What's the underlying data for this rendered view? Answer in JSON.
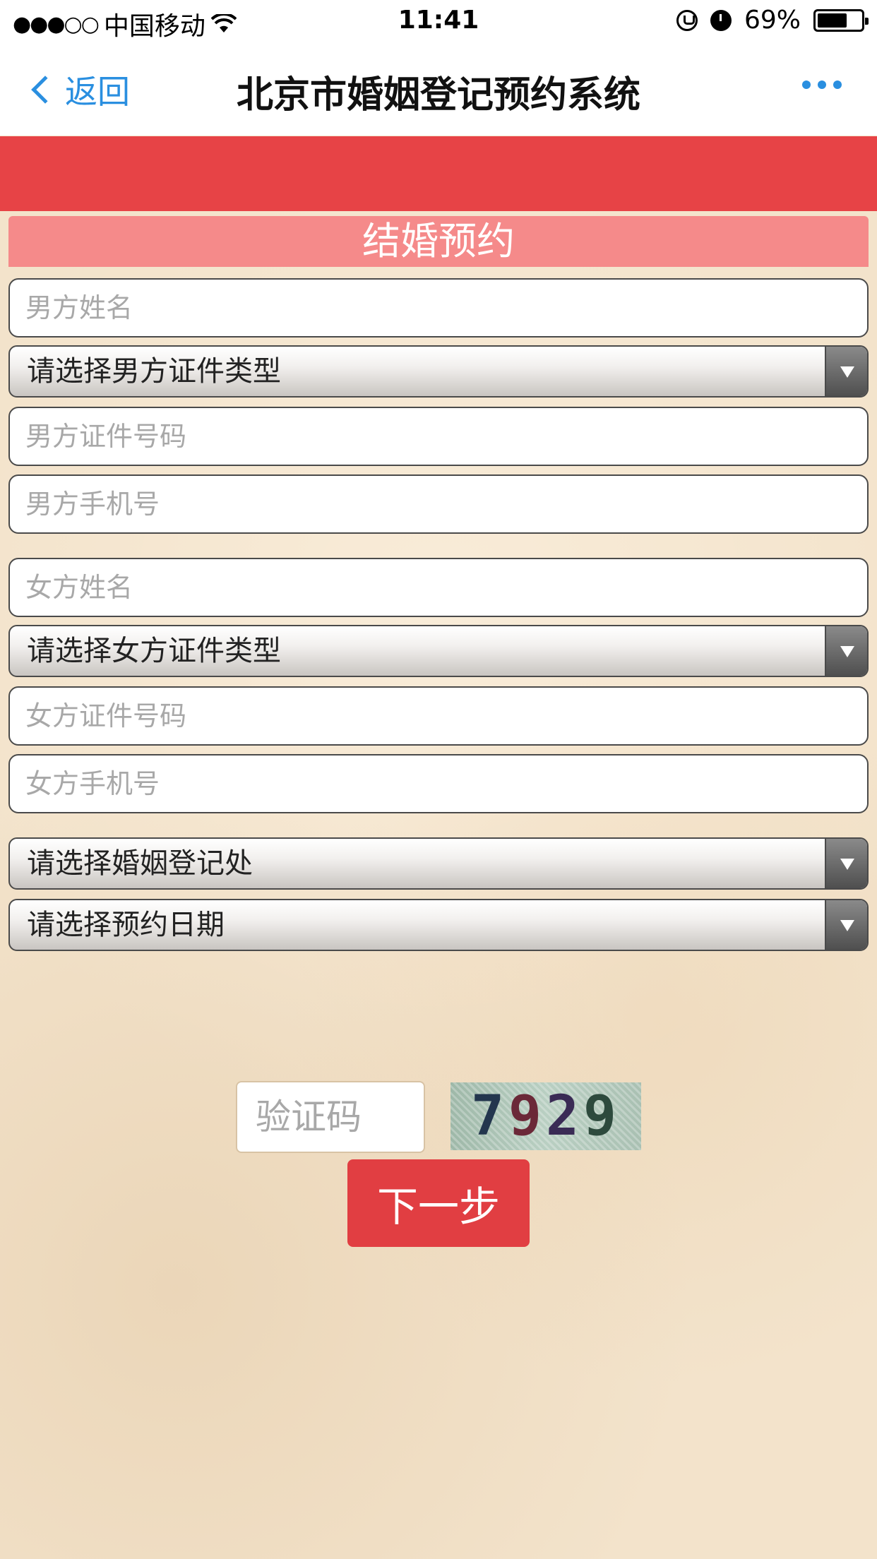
{
  "status_bar": {
    "signal": "●●●○○",
    "carrier": "中国移动",
    "wifi_icon": "wifi-icon",
    "time": "11:41",
    "battery_percent": "69%",
    "battery_level": 0.69
  },
  "nav": {
    "back_label": "返回",
    "title": "北京市婚姻登记预约系统"
  },
  "form": {
    "header": "结婚预约",
    "male_name_placeholder": "男方姓名",
    "male_id_type": "请选择男方证件类型",
    "male_id_number_placeholder": "男方证件号码",
    "male_phone_placeholder": "男方手机号",
    "female_name_placeholder": "女方姓名",
    "female_id_type": "请选择女方证件类型",
    "female_id_number_placeholder": "女方证件号码",
    "female_phone_placeholder": "女方手机号",
    "registry_office": "请选择婚姻登记处",
    "appointment_date": "请选择预约日期",
    "captcha_placeholder": "验证码",
    "captcha_digits": [
      "7",
      "9",
      "2",
      "9"
    ],
    "next_label": "下一步"
  },
  "colors": {
    "accent_blue": "#2a8fe0",
    "header_red": "#e74346",
    "form_header_pink": "#f58a8a",
    "button_red": "#e13e42",
    "background_parchment": "#f3e3cb"
  }
}
